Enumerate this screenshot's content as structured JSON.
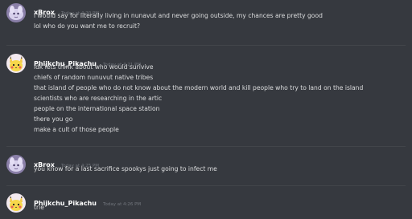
{
  "messages": [
    {
      "username": "xBrox",
      "timestamp": "Today at 4:20 PM",
      "avatar_icon": "lavender-creature-avatar",
      "lines": [
        "i would say for literally living in nunavut and never going outside, my chances are pretty good",
        "lol who do you want me to recruit?"
      ]
    },
    {
      "username": "Phijkchu_Pikachu",
      "timestamp": "Today at 4:21 PM",
      "avatar_icon": "pikachu-avatar",
      "lines": [
        "idk lets think about who would surivive",
        "chiefs of random nunuvut native tribes",
        "that island of people who do not know about the modern world and kill people who try to land on the island",
        "scientists who are researching in the artic",
        "people on the international space station",
        "there you go",
        "make a cult of those people"
      ]
    },
    {
      "username": "xBrox",
      "timestamp": "Today at 4:25 PM",
      "avatar_icon": "lavender-creature-avatar",
      "lines": [
        "you know for a last sacrifice spookys just going to infect me"
      ]
    },
    {
      "username": "Phijkchu_Pikachu",
      "timestamp": "Today at 4:26 PM",
      "avatar_icon": "pikachu-avatar",
      "lines": [
        "trie"
      ]
    }
  ],
  "colors": {
    "background": "#36393f",
    "username": "#ffffff",
    "timestamp": "#72767d",
    "message_text": "#dcddde",
    "divider": "#42454a"
  }
}
